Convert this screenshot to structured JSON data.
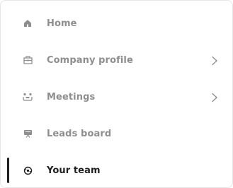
{
  "nav": {
    "items": [
      {
        "label": "Home",
        "icon": "home-icon",
        "has_chevron": false,
        "active": false
      },
      {
        "label": "Company profile",
        "icon": "building-icon",
        "has_chevron": true,
        "active": false
      },
      {
        "label": "Meetings",
        "icon": "meetings-icon",
        "has_chevron": true,
        "active": false
      },
      {
        "label": "Leads board",
        "icon": "board-icon",
        "has_chevron": false,
        "active": false
      },
      {
        "label": "Your team",
        "icon": "team-icon",
        "has_chevron": false,
        "active": true
      }
    ]
  },
  "colors": {
    "inactive_text": "#8e8e8e",
    "active_text": "#1f1f1f",
    "icon_inactive": "#8e8e8e",
    "icon_active": "#1f1f1f",
    "border": "#e6e6e6"
  }
}
